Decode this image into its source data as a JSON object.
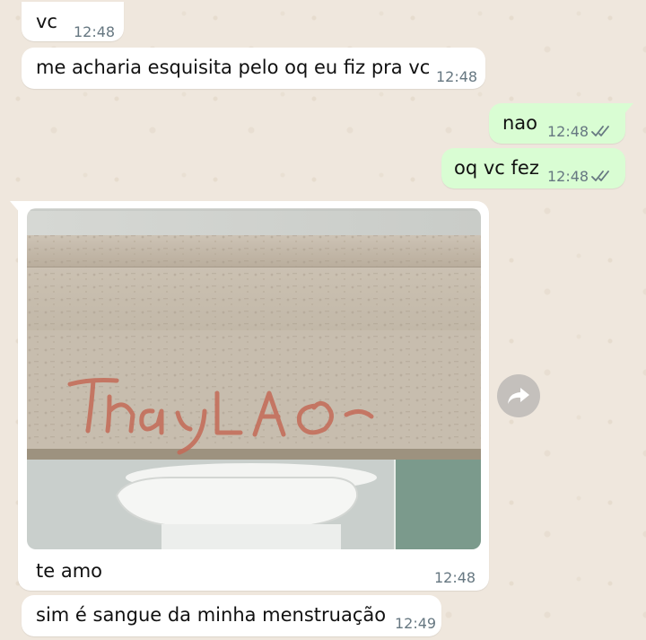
{
  "messages": [
    {
      "direction": "incoming",
      "text": "vc",
      "time": "12:48"
    },
    {
      "direction": "incoming",
      "text": "me acharia esquisita pelo oq eu fiz pra vc",
      "time": "12:48"
    },
    {
      "direction": "outgoing",
      "text": "nao",
      "time": "12:48",
      "status": "read"
    },
    {
      "direction": "outgoing",
      "text": "oq vc fez",
      "time": "12:48",
      "status": "read"
    },
    {
      "direction": "incoming",
      "type": "image",
      "caption": "te amo",
      "time": "12:48",
      "photo_writing": "ThayLA"
    },
    {
      "direction": "incoming",
      "text": "sim é sangue da minha menstruação",
      "time": "12:49"
    }
  ],
  "icons": {
    "read_receipt": "double-check-icon",
    "forward": "forward-icon"
  },
  "colors": {
    "wallpaper": "#efe7dd",
    "incoming_bubble": "#ffffff",
    "outgoing_bubble": "#d9fdd3",
    "timestamp": "#667781",
    "read_ticks": "#53bdeb"
  }
}
